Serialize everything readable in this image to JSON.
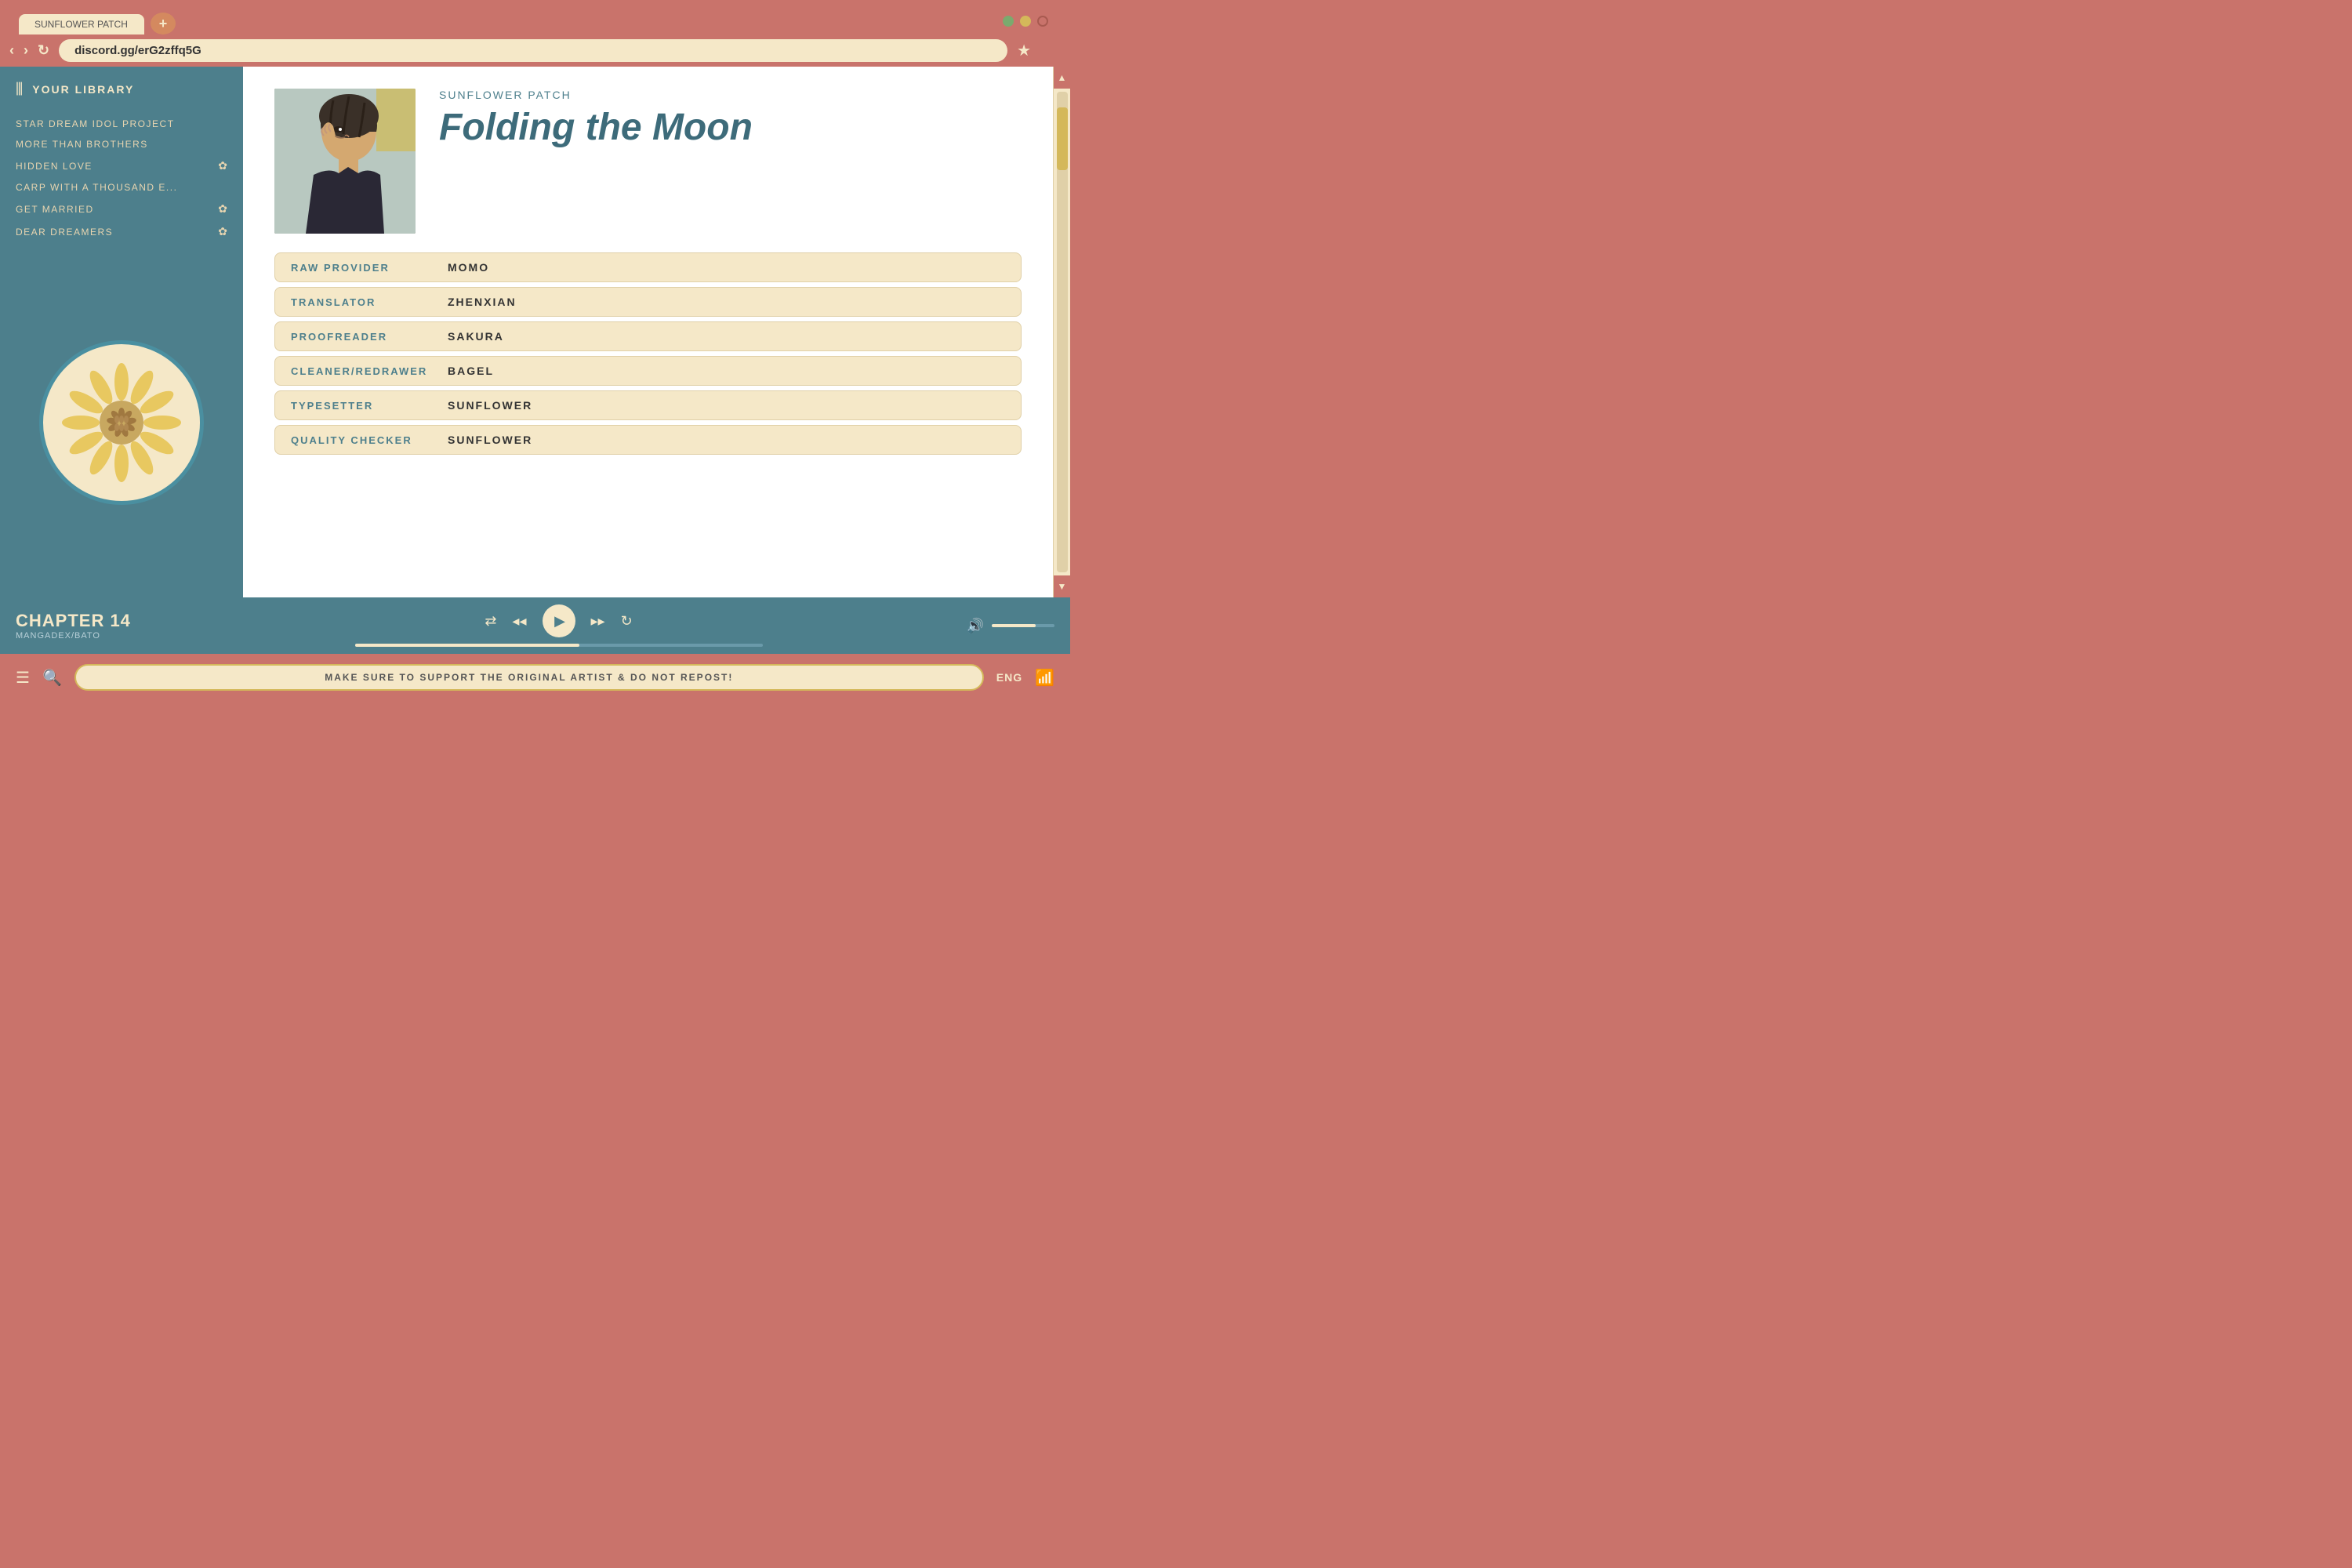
{
  "browser": {
    "url": "discord.gg/erG2zffq5G",
    "tab_label": "SUNFLOWER PATCH",
    "window_controls": {
      "green": "green",
      "yellow": "yellow",
      "red": "red"
    }
  },
  "nav": {
    "back": "‹",
    "forward": "›",
    "refresh": "↻",
    "star": "★"
  },
  "sidebar": {
    "title": "YOUR LIBRARY",
    "items": [
      {
        "label": "STAR DREAM IDOL PROJECT",
        "icon": ""
      },
      {
        "label": "MORE THAN BROTHERS",
        "icon": ""
      },
      {
        "label": "HIDDEN LOVE",
        "icon": "✿"
      },
      {
        "label": "CARP WITH A THOUSAND E...",
        "icon": ""
      },
      {
        "label": "GET MARRIED",
        "icon": "✿"
      },
      {
        "label": "DEAR DREAMERS",
        "icon": "✿"
      }
    ]
  },
  "manga": {
    "series": "SUNFLOWER PATCH",
    "title": "Folding the Moon",
    "credits": [
      {
        "label": "RAW PROVIDER",
        "value": "MOMO"
      },
      {
        "label": "TRANSLATOR",
        "value": "ZHENXIAN"
      },
      {
        "label": "PROOFREADER",
        "value": "SAKURA"
      },
      {
        "label": "CLEANER/REDRAWER",
        "value": "BAGEL"
      },
      {
        "label": "TYPESETTER",
        "value": "SUNFLOWER"
      },
      {
        "label": "QUALITY CHECKER",
        "value": "SUNFLOWER"
      }
    ]
  },
  "player": {
    "chapter": "CHAPTER 14",
    "source": "MANGADEX/BATO",
    "controls": {
      "shuffle": "⇄",
      "prev": "◂◂",
      "play": "▶",
      "next": "▸▸",
      "repeat": "↻"
    },
    "volume_icon": "🔊",
    "progress_percent": 55,
    "volume_percent": 70
  },
  "bottom_bar": {
    "notice": "MAKE SURE TO SUPPORT THE ORIGINAL ARTIST & DO NOT REPOST!",
    "language": "ENG"
  },
  "scrollbar": {
    "up": "▲",
    "down": "▼"
  }
}
